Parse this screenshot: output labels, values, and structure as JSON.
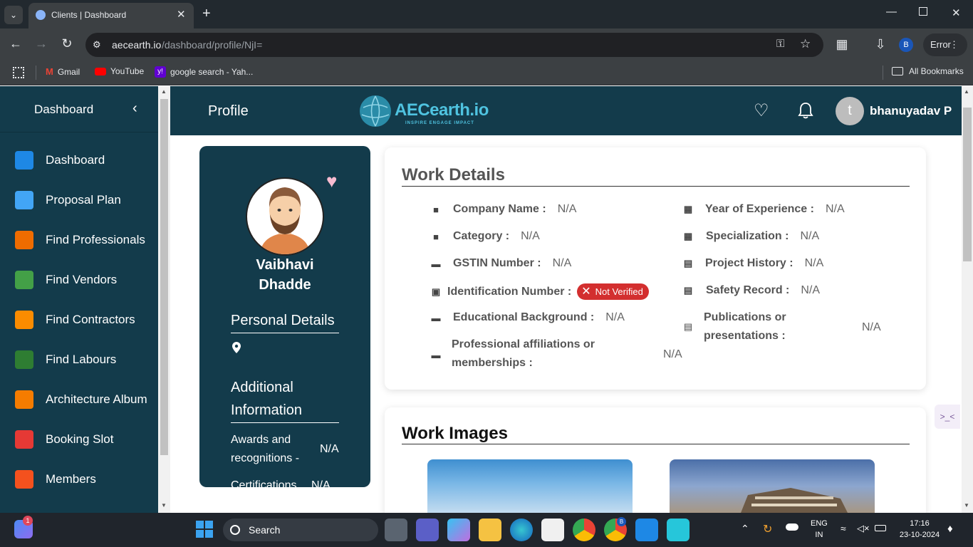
{
  "browser": {
    "tab_title": "Clients | Dashboard",
    "url_domain": "aecearth.io",
    "url_path": "/dashboard/profile/NjI=",
    "profile_initial": "B",
    "error_label": "Error",
    "bookmarks": [
      {
        "label": "Gmail"
      },
      {
        "label": "YouTube"
      },
      {
        "label": "google search - Yah..."
      }
    ],
    "all_bookmarks": "All Bookmarks"
  },
  "sidebar": {
    "title": "Dashboard",
    "items": [
      {
        "label": "Dashboard",
        "icon": "dashboard-icon",
        "color": "#1e88e5"
      },
      {
        "label": "Proposal Plan",
        "icon": "document-icon",
        "color": "#42a5f5"
      },
      {
        "label": "Find Professionals",
        "icon": "professional-icon",
        "color": "#ef6c00"
      },
      {
        "label": "Find Vendors",
        "icon": "store-icon",
        "color": "#43a047"
      },
      {
        "label": "Find Contractors",
        "icon": "gear-icon",
        "color": "#fb8c00"
      },
      {
        "label": "Find Labours",
        "icon": "worker-icon",
        "color": "#2e7d32"
      },
      {
        "label": "Architecture Album",
        "icon": "album-icon",
        "color": "#f57c00"
      },
      {
        "label": "Booking Slot",
        "icon": "calendar-icon",
        "color": "#e53935"
      },
      {
        "label": "Members",
        "icon": "members-icon",
        "color": "#f4511e"
      }
    ]
  },
  "header": {
    "title": "Profile",
    "logo_text": "AECearth.io",
    "logo_tagline": "INSPIRE ENGAGE IMPACT",
    "avatar_initial": "t",
    "username": "bhanuyadav P"
  },
  "profile": {
    "first_name": "Vaibhavi",
    "last_name": "Dhadde",
    "personal_details_heading": "Personal Details",
    "additional_info_heading_1": "Additional",
    "additional_info_heading_2": "Information",
    "awards_label_1": "Awards and",
    "awards_label_2": "recognitions -",
    "awards_value": "N/A",
    "certifications_label": "Certifications",
    "certifications_value": "N/A"
  },
  "work_details": {
    "heading": "Work Details",
    "left": [
      {
        "label": "Company Name :",
        "value": "N/A",
        "icon": "factory-icon"
      },
      {
        "label": "Category :",
        "value": "N/A",
        "icon": "factory-icon"
      },
      {
        "label": "GSTIN Number :",
        "value": "N/A",
        "icon": "ticket-icon"
      },
      {
        "label": "Identification Number :",
        "badge": "Not Verified",
        "icon": "id-card-icon"
      },
      {
        "label": "Educational Background :",
        "value": "N/A",
        "icon": "ticket-icon"
      },
      {
        "label_1": "Professional affiliations or",
        "label_2": "memberships :",
        "value": "N/A",
        "icon": "ticket-icon"
      }
    ],
    "right": [
      {
        "label": "Year of Experience :",
        "value": "N/A",
        "icon": "calendar-icon"
      },
      {
        "label": "Specialization :",
        "value": "N/A",
        "icon": "calendar-icon"
      },
      {
        "label": "Project History :",
        "value": "N/A",
        "icon": "file-icon"
      },
      {
        "label": "Safety Record :",
        "value": "N/A",
        "icon": "file-icon"
      },
      {
        "label_1": "Publications or",
        "label_2": "presentations :",
        "value": "N/A",
        "icon": "file-icon"
      }
    ]
  },
  "work_images": {
    "heading": "Work Images"
  },
  "taskbar": {
    "search_placeholder": "Search",
    "language_1": "ENG",
    "language_2": "IN",
    "time": "17:16",
    "date": "23-10-2024",
    "widget_badge": "1",
    "chrome_badge": "B"
  },
  "colors": {
    "primary": "#133b4b",
    "not_verified": "#d32f2f"
  }
}
